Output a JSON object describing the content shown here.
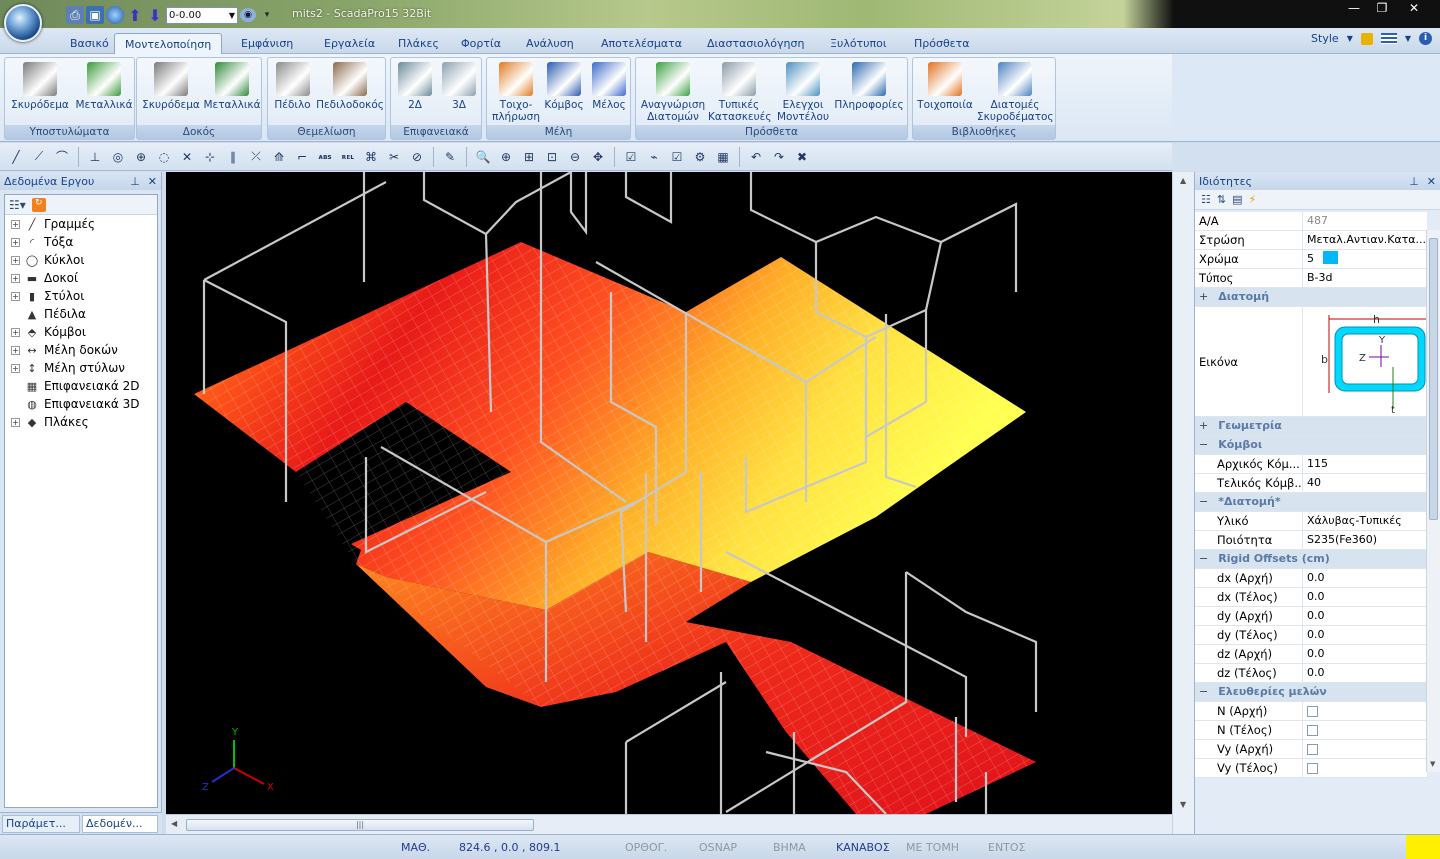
{
  "window": {
    "title": "mits2 - ScadaPro15 32Bit",
    "qat_select_value": "0-0.00"
  },
  "tabs": [
    "Βασικό",
    "Μοντελοποίηση",
    "Εμφάνιση",
    "Εργαλεία",
    "Πλάκες",
    "Φορτία",
    "Ανάλυση",
    "Αποτελέσματα",
    "Διαστασιολόγηση",
    "Ξυλότυποι",
    "Πρόσθετα"
  ],
  "active_tab": "Μοντελοποίηση",
  "style_label": "Style",
  "ribbon": {
    "groups": [
      {
        "caption": "Υποστυλώματα",
        "buttons": [
          {
            "line1": "Σκυρόδεμα",
            "line2": ""
          },
          {
            "line1": "Μεταλλικά",
            "line2": ""
          }
        ]
      },
      {
        "caption": "Δοκός",
        "buttons": [
          {
            "line1": "Σκυρόδεμα",
            "line2": ""
          },
          {
            "line1": "Μεταλλικά",
            "line2": ""
          }
        ]
      },
      {
        "caption": "Θεμελίωση",
        "buttons": [
          {
            "line1": "Πέδιλο",
            "line2": ""
          },
          {
            "line1": "Πεδιλοδοκός",
            "line2": ""
          }
        ]
      },
      {
        "caption": "Επιφανειακά",
        "buttons": [
          {
            "line1": "2Δ",
            "line2": ""
          },
          {
            "line1": "3Δ",
            "line2": ""
          }
        ]
      },
      {
        "caption": "Μέλη",
        "buttons": [
          {
            "line1": "Τοιχο-",
            "line2": "πλήρωση"
          },
          {
            "line1": "Κόμβος",
            "line2": ""
          },
          {
            "line1": "Μέλος",
            "line2": ""
          }
        ]
      },
      {
        "caption": "Πρόσθετα",
        "buttons": [
          {
            "line1": "Αναγνώριση",
            "line2": "Διατομών"
          },
          {
            "line1": "Τυπικές",
            "line2": "Κατασκευές"
          },
          {
            "line1": "Ελεγχοι",
            "line2": "Μοντέλου"
          },
          {
            "line1": "Πληροφορίες",
            "line2": ""
          }
        ]
      },
      {
        "caption": "Βιβλιοθήκες",
        "buttons": [
          {
            "line1": "Τοιχοποιία",
            "line2": ""
          },
          {
            "line1": "Διατομές",
            "line2": "Σκυροδέματος"
          }
        ]
      }
    ]
  },
  "left_panel": {
    "title": "Δεδομένα Εργου",
    "items": [
      {
        "label": "Γραμμές",
        "icon": "line-icon"
      },
      {
        "label": "Τόξα",
        "icon": "arc-icon"
      },
      {
        "label": "Κύκλοι",
        "icon": "circle-icon"
      },
      {
        "label": "Δοκοί",
        "icon": "beam-icon"
      },
      {
        "label": "Στύλοι",
        "icon": "column-icon"
      },
      {
        "label": "Πέδιλα",
        "icon": "footing-icon"
      },
      {
        "label": "Κόμβοι",
        "icon": "node-icon"
      },
      {
        "label": "Μέλη δοκών",
        "icon": "beam-member-icon"
      },
      {
        "label": "Μέλη στύλων",
        "icon": "column-member-icon"
      },
      {
        "label": "Επιφανειακά 2D",
        "icon": "mesh2d-icon"
      },
      {
        "label": "Επιφανειακά 3D",
        "icon": "mesh3d-icon"
      },
      {
        "label": "Πλάκες",
        "icon": "slab-icon"
      }
    ],
    "bottom_tabs": [
      "Παράμετ...",
      "Δεδομέν..."
    ]
  },
  "properties": {
    "title": "Ιδιότητες",
    "rows": [
      {
        "type": "kv",
        "key": "Α/Α",
        "value": "487",
        "muted": true
      },
      {
        "type": "kv",
        "key": "Στρώση",
        "value": "Μεταλ.Αντιαν.Κατα..."
      },
      {
        "type": "kv",
        "key": "Χρώμα",
        "value": "5",
        "swatch": "#00b7ff"
      },
      {
        "type": "kv",
        "key": "Τύπος",
        "value": "B-3d"
      },
      {
        "type": "cat",
        "key": "Διατομή",
        "sign": "+"
      },
      {
        "type": "image",
        "key": "Εικόνα"
      },
      {
        "type": "cat",
        "key": "Γεωμετρία",
        "sign": "+"
      },
      {
        "type": "cat",
        "key": "Κόμβοι",
        "sign": "−"
      },
      {
        "type": "kv",
        "key": "Αρχικός Κόμ...",
        "value": "115",
        "indent": true
      },
      {
        "type": "kv",
        "key": "Τελικός Κόμβ...",
        "value": "40",
        "indent": true
      },
      {
        "type": "cat",
        "key": "*Διατομή*",
        "sign": "−"
      },
      {
        "type": "kv",
        "key": "Υλικό",
        "value": "Χάλυβας-Τυπικές",
        "indent": true
      },
      {
        "type": "kv",
        "key": "Ποιότητα",
        "value": "S235(Fe360)",
        "indent": true
      },
      {
        "type": "cat",
        "key": "Rigid Offsets (cm)",
        "sign": "−"
      },
      {
        "type": "kv",
        "key": "dx (Αρχή)",
        "value": "0.0",
        "indent": true
      },
      {
        "type": "kv",
        "key": "dx (Τέλος)",
        "value": "0.0",
        "indent": true
      },
      {
        "type": "kv",
        "key": "dy (Αρχή)",
        "value": "0.0",
        "indent": true
      },
      {
        "type": "kv",
        "key": "dy (Τέλος)",
        "value": "0.0",
        "indent": true
      },
      {
        "type": "kv",
        "key": "dz (Αρχή)",
        "value": "0.0",
        "indent": true
      },
      {
        "type": "kv",
        "key": "dz (Τέλος)",
        "value": "0.0",
        "indent": true
      },
      {
        "type": "cat",
        "key": "Ελευθερίες μελών",
        "sign": "−"
      },
      {
        "type": "check",
        "key": "N (Αρχή)",
        "indent": true
      },
      {
        "type": "check",
        "key": "N (Τέλος)",
        "indent": true
      },
      {
        "type": "check",
        "key": "Vy (Αρχή)",
        "indent": true
      },
      {
        "type": "check",
        "key": "Vy (Τέλος)",
        "indent": true
      }
    ],
    "section_labels": {
      "h": "h",
      "b": "b",
      "t": "t",
      "y": "Y",
      "z": "Z"
    }
  },
  "axes": {
    "x": "X",
    "y": "Y",
    "z": "Z"
  },
  "status": {
    "mode": "ΜΑΘ.",
    "coords": "824.6 , 0.0 , 809.1",
    "toggles": [
      {
        "label": "ΟΡΘΟΓ.",
        "on": false
      },
      {
        "label": "OSNAP",
        "on": false
      },
      {
        "label": "ΒΗΜΑ",
        "on": false
      },
      {
        "label": "ΚΑΝΑΒΟΣ",
        "on": true
      },
      {
        "label": "ΜΕ ΤΟΜΗ",
        "on": false
      },
      {
        "label": "ΕΝΤΟΣ",
        "on": false
      }
    ]
  },
  "colors": {
    "accent": "#15428b",
    "status_on": "#1e3d8f",
    "status_off": "#8c98a8",
    "mesh_hot": "#e0121a",
    "mesh_cold": "#ffff40"
  }
}
